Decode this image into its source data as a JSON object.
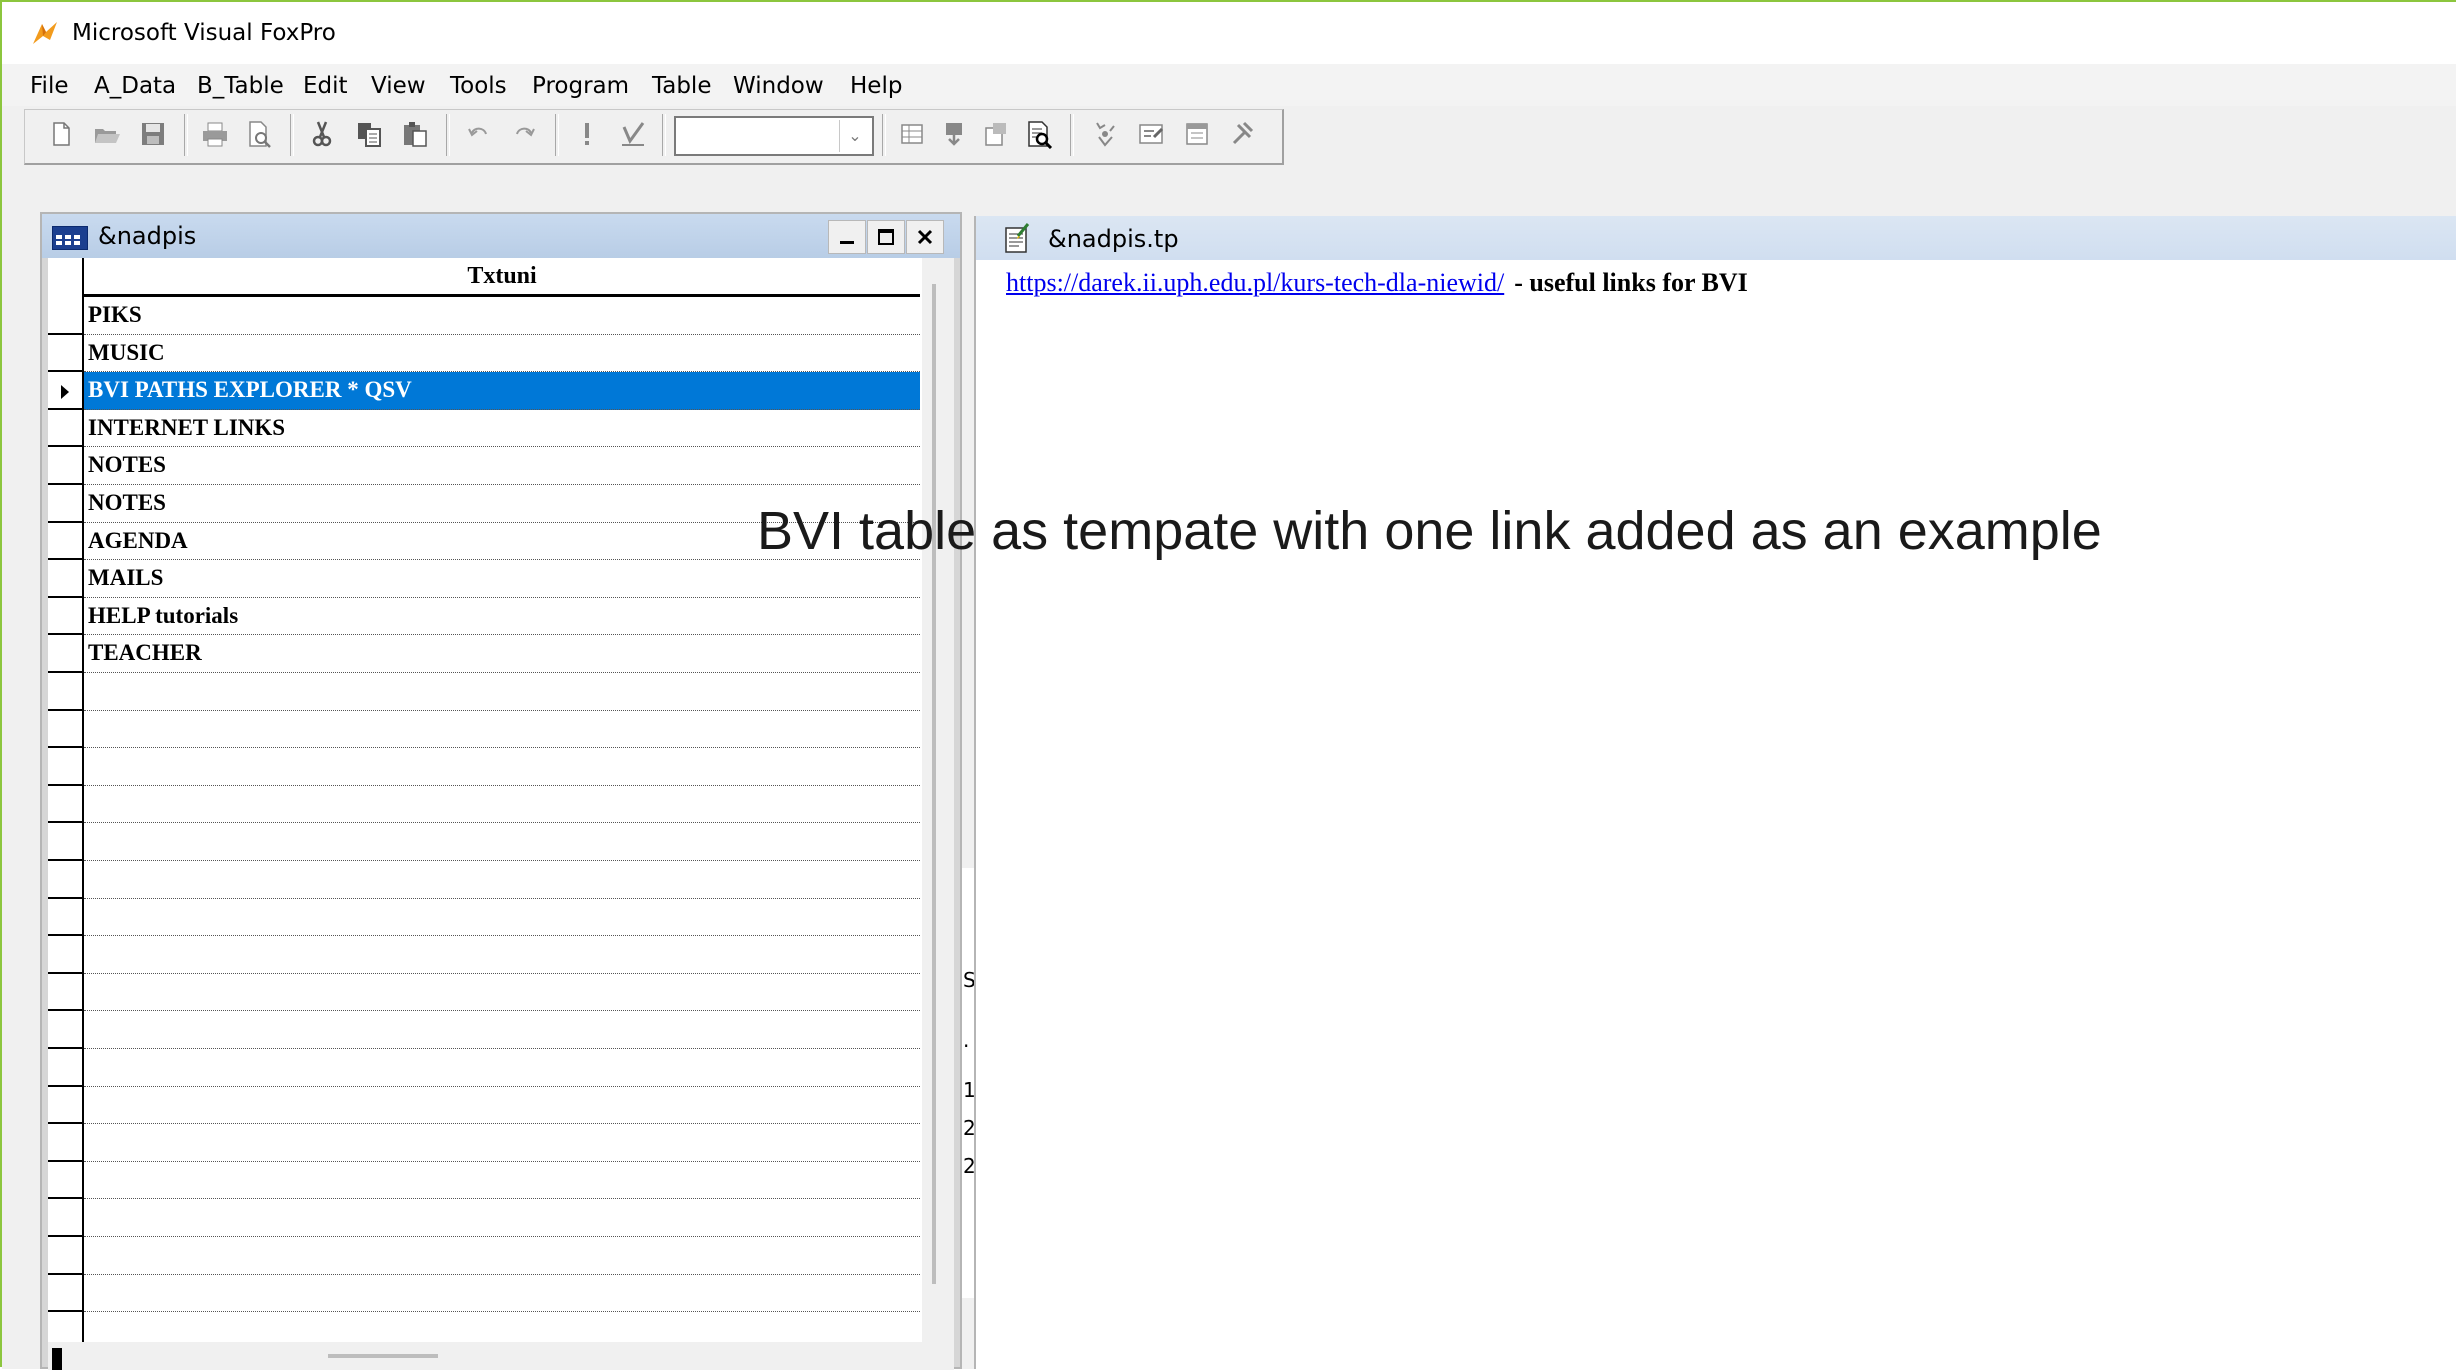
{
  "window": {
    "title": "Microsoft Visual FoxPro"
  },
  "menu": [
    "File",
    "A_Data",
    "B_Table",
    "Edit",
    "View",
    "Tools",
    "Program",
    "Table",
    "Window",
    "Help"
  ],
  "toolbar": {
    "combo_value": "",
    "icons": [
      "new-file-icon",
      "open-icon",
      "save-icon",
      "print-icon",
      "print-preview-icon",
      "cut-icon",
      "copy-icon",
      "paste-icon",
      "undo-icon",
      "redo-icon",
      "run-icon",
      "modify-form-icon",
      "database-icon",
      "command-window-icon",
      "properties-icon",
      "code-icon",
      "data-session-icon",
      "form-wizard-icon",
      "report-wizard-icon",
      "builder-icon"
    ]
  },
  "browse": {
    "title": "&nadpis",
    "column_header": "Txtuni",
    "selected_index": 2,
    "rows": [
      "PIKS",
      "MUSIC",
      "BVI PATHS EXPLORER  *  QSV",
      "INTERNET LINKS",
      "NOTES",
      "NOTES",
      "AGENDA",
      "MAILS",
      "HELP tutorials",
      "TEACHER",
      "",
      "",
      "",
      "",
      "",
      "",
      "",
      "",
      "",
      "",
      "",
      "",
      "",
      "",
      "",
      "",
      "",
      ""
    ]
  },
  "editor": {
    "title": "&nadpis.tp",
    "link": "https://darek.ii.uph.edu.pl/kurs-tech-dla-niewid/",
    "description": "- useful links for BVI"
  },
  "background_window": {
    "chars": [
      "S",
      ".",
      "1",
      "2",
      "2"
    ]
  },
  "annotation": "BVI table as tempate with one link added as an example",
  "colors": {
    "selection": "#0078d7",
    "accent_border": "#8cc63e",
    "titlebar_inactive": "#c9daef"
  }
}
